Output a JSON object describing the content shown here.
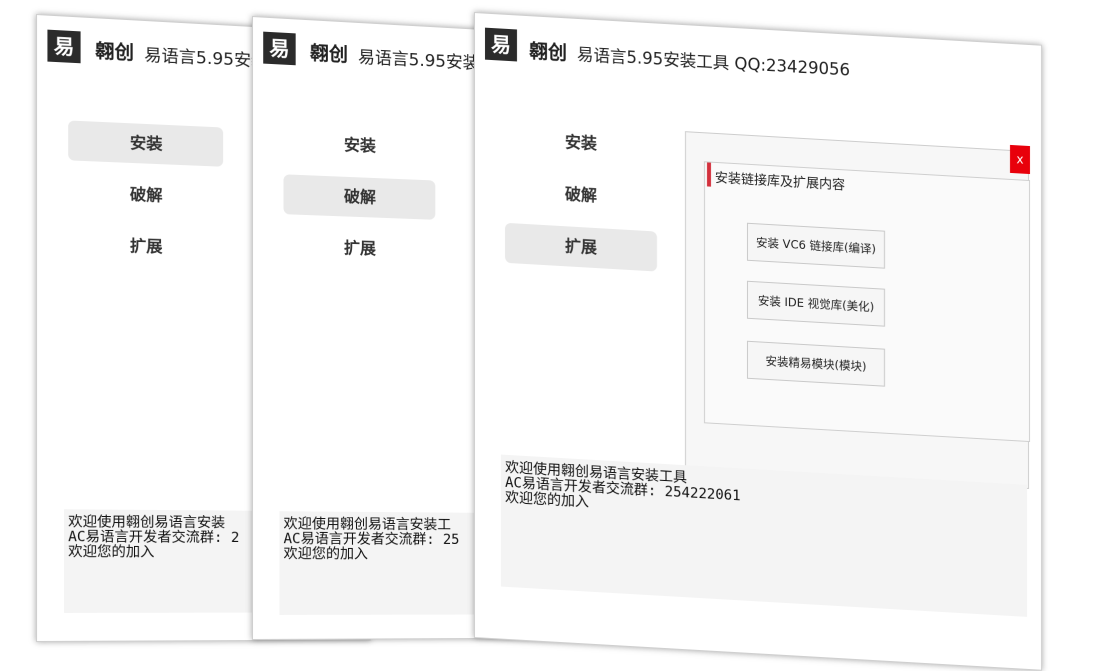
{
  "app": {
    "brand": "翱创",
    "title": "易语言5.95安装工具 QQ:23429056",
    "title_truncated": "易语言5.95安装"
  },
  "logo_char": "易",
  "nav": {
    "install": "安装",
    "crack": "破解",
    "extend": "扩展"
  },
  "log_lines": [
    "欢迎使用翱创易语言安装工具",
    "AC易语言开发者交流群: 254222061",
    "欢迎您的加入"
  ],
  "log_lines_w1": [
    "欢迎使用翱创易语言安装",
    "AC易语言开发者交流群: 2",
    "欢迎您的加入"
  ],
  "log_lines_w2": [
    "欢迎使用翱创易语言安装工",
    "AC易语言开发者交流群: 25",
    "欢迎您的加入"
  ],
  "panel": {
    "close": "x",
    "group_title": "安装链接库及扩展内容",
    "buttons": {
      "vc6": "安装 VC6 链接库(编译)",
      "ide": "安装 IDE 视觉库(美化)",
      "module": "安装精易模块(模块)"
    }
  },
  "colors": {
    "accent_red": "#d3303c",
    "close_red": "#e8000b",
    "active_tab": "#e9e9e9"
  }
}
